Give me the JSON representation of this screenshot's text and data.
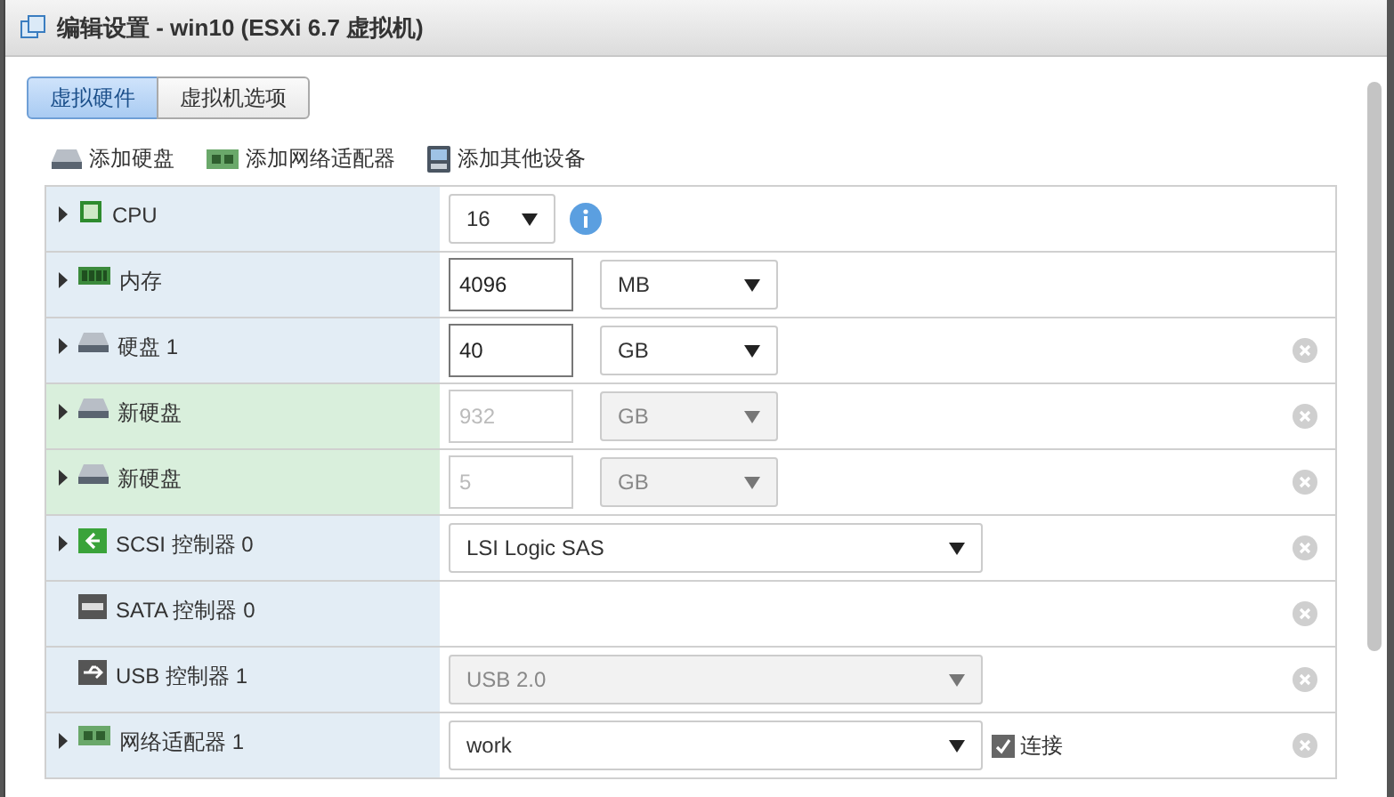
{
  "window": {
    "title": "编辑设置 - win10 (ESXi 6.7 虚拟机)"
  },
  "tabs": [
    {
      "label": "虚拟硬件",
      "selected": true
    },
    {
      "label": "虚拟机选项",
      "selected": false
    }
  ],
  "toolbar": [
    {
      "label": "添加硬盘",
      "kind": "disk"
    },
    {
      "label": "添加网络适配器",
      "kind": "network"
    },
    {
      "label": "添加其他设备",
      "kind": "device"
    }
  ],
  "devices": [
    {
      "label": "CPU",
      "kind": "cpu",
      "expandable": true,
      "new": false,
      "removable": false,
      "info": true,
      "controls": [
        {
          "kind": "small_select",
          "value": "16",
          "disabled": false
        }
      ]
    },
    {
      "label": "内存",
      "kind": "memory",
      "expandable": true,
      "new": false,
      "removable": false,
      "controls": [
        {
          "kind": "number",
          "value": "4096",
          "disabled": false
        },
        {
          "kind": "unit",
          "value": "MB",
          "disabled": false
        }
      ]
    },
    {
      "label": "硬盘 1",
      "kind": "disk",
      "expandable": true,
      "new": false,
      "removable": true,
      "controls": [
        {
          "kind": "number",
          "value": "40",
          "disabled": false
        },
        {
          "kind": "unit",
          "value": "GB",
          "disabled": false
        }
      ]
    },
    {
      "label": "新硬盘",
      "kind": "disk",
      "expandable": true,
      "new": true,
      "removable": true,
      "controls": [
        {
          "kind": "number",
          "value": "932",
          "disabled": true
        },
        {
          "kind": "unit",
          "value": "GB",
          "disabled": true
        }
      ]
    },
    {
      "label": "新硬盘",
      "kind": "disk",
      "expandable": true,
      "new": true,
      "removable": true,
      "controls": [
        {
          "kind": "number",
          "value": "5",
          "disabled": true
        },
        {
          "kind": "unit",
          "value": "GB",
          "disabled": true
        }
      ]
    },
    {
      "label": "SCSI 控制器 0",
      "kind": "scsi",
      "expandable": true,
      "new": false,
      "removable": true,
      "controls": [
        {
          "kind": "wide_select",
          "value": "LSI Logic SAS",
          "disabled": false
        }
      ]
    },
    {
      "label": "SATA 控制器 0",
      "kind": "sata",
      "expandable": false,
      "new": false,
      "removable": true
    },
    {
      "label": "USB 控制器 1",
      "kind": "usb",
      "expandable": false,
      "new": false,
      "removable": true,
      "controls": [
        {
          "kind": "wide_select",
          "value": "USB 2.0",
          "disabled": true
        }
      ]
    },
    {
      "label": "网络适配器 1",
      "kind": "network",
      "expandable": true,
      "new": false,
      "removable": true,
      "controls": [
        {
          "kind": "wide_select",
          "value": "work",
          "disabled": false
        },
        {
          "kind": "checkbox",
          "label": "连接",
          "checked": true
        }
      ]
    }
  ]
}
